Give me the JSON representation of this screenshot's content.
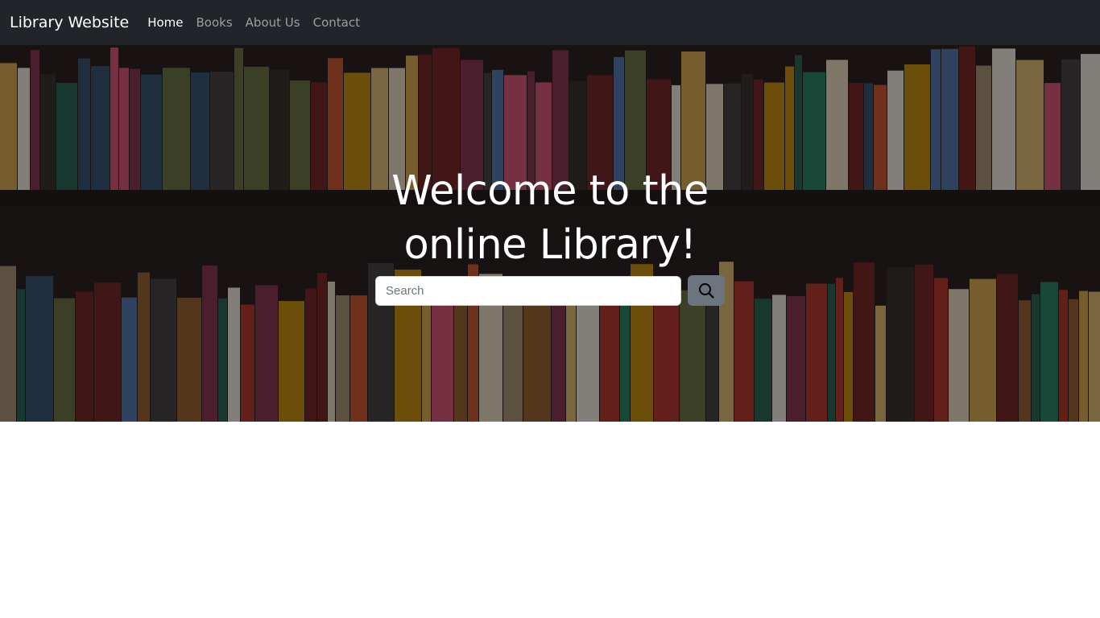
{
  "navbar": {
    "brand": "Library Website",
    "links": [
      {
        "label": "Home",
        "active": true
      },
      {
        "label": "Books",
        "active": false
      },
      {
        "label": "About Us",
        "active": false
      },
      {
        "label": "Contact",
        "active": false
      }
    ]
  },
  "hero": {
    "title_line1": "Welcome to the",
    "title_line2": "online Library!",
    "background": "bookshelf-photo",
    "search": {
      "placeholder": "Search",
      "value": "",
      "button_icon": "search-icon"
    }
  },
  "colors": {
    "navbar_bg": "#212529",
    "search_button_bg": "#6c757d",
    "hero_text": "#ffffff"
  }
}
